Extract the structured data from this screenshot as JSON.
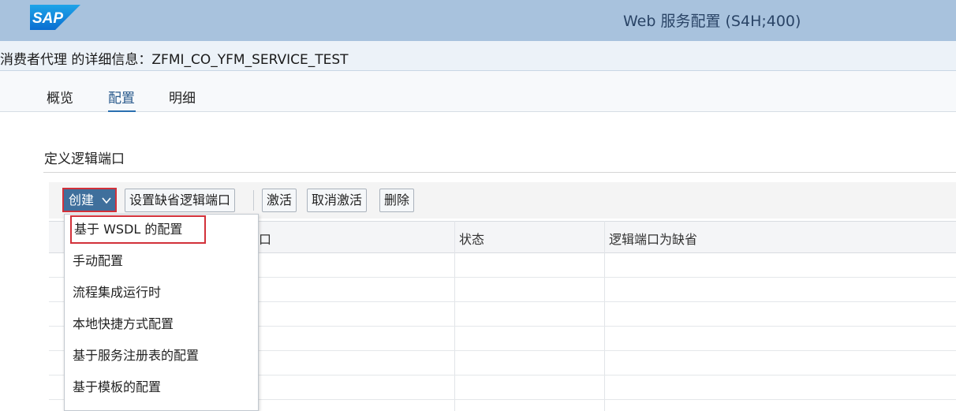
{
  "shell": {
    "logo_text": "SAP",
    "title": "Web 服务配置 (S4H;400)",
    "brand_color": "#0a6ed1"
  },
  "page": {
    "title": "消费者代理 的详细信息：ZFMI_CO_YFM_SERVICE_TEST"
  },
  "tabs": [
    {
      "label": "概览"
    },
    {
      "label": "配置",
      "active": true
    },
    {
      "label": "明细"
    }
  ],
  "section": {
    "title": "定义逻辑端口"
  },
  "toolbar": {
    "create_label": "创建",
    "set_default_label": "设置缺省逻辑端口",
    "activate_label": "激活",
    "deactivate_label": "取消激活",
    "delete_label": "删除"
  },
  "table": {
    "columns": [
      "口",
      "状态",
      "逻辑端口为缺省"
    ]
  },
  "menu": {
    "items": [
      {
        "label": "基于 WSDL 的配置",
        "selected": true
      },
      {
        "label": "手动配置"
      },
      {
        "label": "流程集成运行时"
      },
      {
        "label": "本地快捷方式配置"
      },
      {
        "label": "基于服务注册表的配置"
      },
      {
        "label": "基于模板的配置"
      }
    ]
  }
}
